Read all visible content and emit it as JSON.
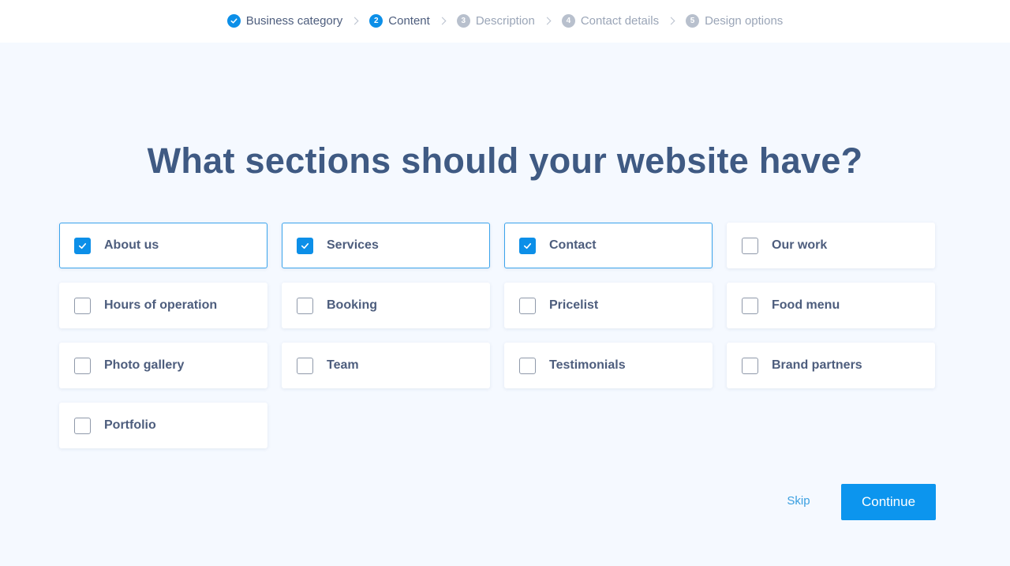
{
  "steps": [
    {
      "num": "",
      "label": "Business category",
      "state": "done"
    },
    {
      "num": "2",
      "label": "Content",
      "state": "active"
    },
    {
      "num": "3",
      "label": "Description",
      "state": "pending"
    },
    {
      "num": "4",
      "label": "Contact details",
      "state": "pending"
    },
    {
      "num": "5",
      "label": "Design options",
      "state": "pending"
    }
  ],
  "heading": "What sections should your website have?",
  "options": [
    {
      "label": "About us",
      "checked": true
    },
    {
      "label": "Services",
      "checked": true
    },
    {
      "label": "Contact",
      "checked": true
    },
    {
      "label": "Our work",
      "checked": false
    },
    {
      "label": "Hours of operation",
      "checked": false
    },
    {
      "label": "Booking",
      "checked": false
    },
    {
      "label": "Pricelist",
      "checked": false
    },
    {
      "label": "Food menu",
      "checked": false
    },
    {
      "label": "Photo gallery",
      "checked": false
    },
    {
      "label": "Team",
      "checked": false
    },
    {
      "label": "Testimonials",
      "checked": false
    },
    {
      "label": "Brand partners",
      "checked": false
    },
    {
      "label": "Portfolio",
      "checked": false
    }
  ],
  "actions": {
    "skip_label": "Skip",
    "continue_label": "Continue"
  },
  "colors": {
    "accent": "#0c8fe8",
    "heading": "#3f5a83",
    "background": "#f5f9ff"
  }
}
